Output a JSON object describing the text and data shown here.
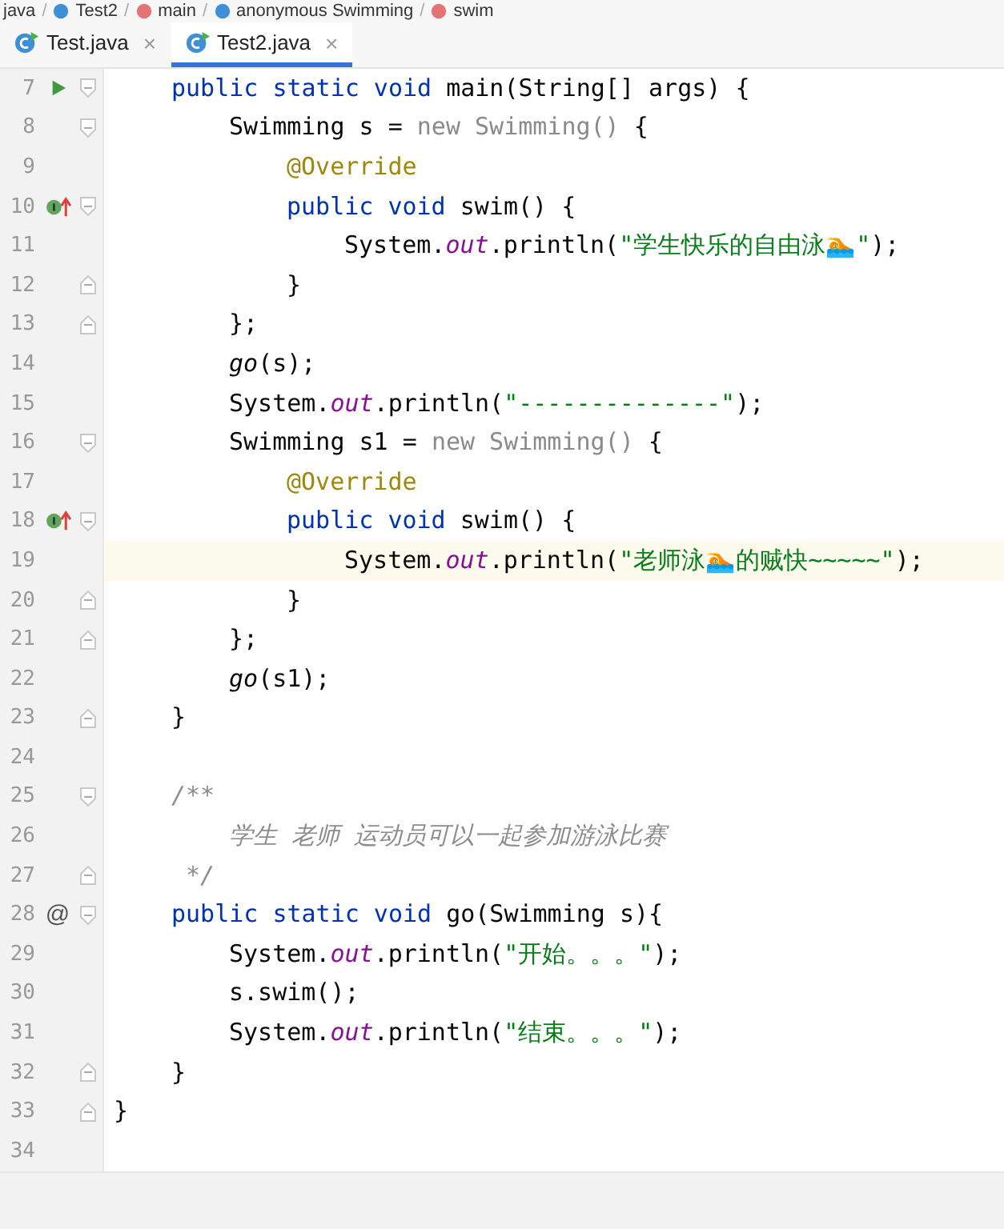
{
  "breadcrumb": [
    {
      "kind": "folder",
      "label": "java",
      "separator": "/"
    },
    {
      "kind": "class",
      "label": "Test2",
      "separator": "/"
    },
    {
      "kind": "method",
      "label": "main",
      "separator": "/"
    },
    {
      "kind": "anon",
      "label": "anonymous Swimming",
      "separator": "/"
    },
    {
      "kind": "method",
      "label": "swim"
    }
  ],
  "tabs": [
    {
      "label": "Test.java",
      "close": "×",
      "selected": false
    },
    {
      "label": "Test2.java",
      "close": "×",
      "selected": true
    }
  ],
  "lines": [
    {
      "num": "7",
      "gutter": {
        "kind": "run"
      },
      "fold": {
        "kind": "open"
      },
      "current": false,
      "tokens": [
        {
          "kind": "kw",
          "t": "public static void "
        },
        {
          "kind": "plain",
          "t": "main(String[] args) {"
        }
      ],
      "children": [
        {
          "num": "8",
          "fold": {
            "kind": "open"
          },
          "current": false,
          "tokens": [
            {
              "kind": "plain",
              "t": "Swimming s = "
            },
            {
              "kind": "dim",
              "t": "new Swimming() "
            },
            {
              "kind": "plain",
              "t": "{"
            }
          ],
          "children": [
            {
              "num": "9",
              "current": false,
              "tokens": [
                {
                  "kind": "ann",
                  "t": "@Override"
                }
              ]
            },
            {
              "num": "10",
              "gutter": {
                "kind": "impl"
              },
              "fold": {
                "kind": "open"
              },
              "current": false,
              "tokens": [
                {
                  "kind": "kw",
                  "t": "public void "
                },
                {
                  "kind": "plain",
                  "t": "swim() {"
                }
              ],
              "children": [
                {
                  "num": "11",
                  "current": false,
                  "tokens": [
                    {
                      "kind": "plain",
                      "t": "System."
                    },
                    {
                      "kind": "field",
                      "t": "out"
                    },
                    {
                      "kind": "plain",
                      "t": ".println("
                    },
                    {
                      "kind": "str",
                      "t": "\"学生快乐的自由泳🏊\""
                    },
                    {
                      "kind": "plain",
                      "t": ");"
                    }
                  ]
                }
              ]
            },
            {
              "num": "12",
              "fold": {
                "kind": "close"
              },
              "current": false,
              "tokens": [
                {
                  "kind": "plain",
                  "t": "}"
                }
              ]
            }
          ]
        },
        {
          "num": "13",
          "fold": {
            "kind": "close"
          },
          "current": false,
          "tokens": [
            {
              "kind": "plain",
              "t": "};"
            }
          ]
        },
        {
          "num": "14",
          "current": false,
          "tokens": [
            {
              "kind": "it",
              "t": "go"
            },
            {
              "kind": "plain",
              "t": "(s);"
            }
          ]
        },
        {
          "num": "15",
          "current": false,
          "tokens": [
            {
              "kind": "plain",
              "t": "System."
            },
            {
              "kind": "field",
              "t": "out"
            },
            {
              "kind": "plain",
              "t": ".println("
            },
            {
              "kind": "str",
              "t": "\"--------------\""
            },
            {
              "kind": "plain",
              "t": ");"
            }
          ]
        },
        {
          "num": "16",
          "fold": {
            "kind": "open"
          },
          "current": false,
          "tokens": [
            {
              "kind": "plain",
              "t": "Swimming s1 = "
            },
            {
              "kind": "dim",
              "t": "new Swimming() "
            },
            {
              "kind": "plain",
              "t": "{"
            }
          ],
          "children": [
            {
              "num": "17",
              "current": false,
              "tokens": [
                {
                  "kind": "ann",
                  "t": "@Override"
                }
              ]
            },
            {
              "num": "18",
              "gutter": {
                "kind": "impl"
              },
              "fold": {
                "kind": "open"
              },
              "current": false,
              "tokens": [
                {
                  "kind": "kw",
                  "t": "public void "
                },
                {
                  "kind": "plain",
                  "t": "swim() {"
                }
              ],
              "children": [
                {
                  "num": "19",
                  "current": true,
                  "tokens": [
                    {
                      "kind": "plain",
                      "t": "System."
                    },
                    {
                      "kind": "field",
                      "t": "out"
                    },
                    {
                      "kind": "plain",
                      "t": ".println("
                    },
                    {
                      "kind": "str",
                      "t": "\"老师泳🏊的贼快~~~~~\""
                    },
                    {
                      "kind": "plain",
                      "t": ");"
                    }
                  ]
                }
              ]
            },
            {
              "num": "20",
              "fold": {
                "kind": "close"
              },
              "current": false,
              "tokens": [
                {
                  "kind": "plain",
                  "t": "}"
                }
              ]
            }
          ]
        },
        {
          "num": "21",
          "fold": {
            "kind": "close"
          },
          "current": false,
          "tokens": [
            {
              "kind": "plain",
              "t": "};"
            }
          ]
        },
        {
          "num": "22",
          "current": false,
          "tokens": [
            {
              "kind": "it",
              "t": "go"
            },
            {
              "kind": "plain",
              "t": "(s1);"
            }
          ]
        }
      ]
    },
    {
      "num": "23",
      "fold": {
        "kind": "close"
      },
      "current": false,
      "tokens": [
        {
          "kind": "plain",
          "t": "}"
        }
      ]
    },
    {
      "num": "24",
      "current": false
    },
    {
      "num": "25",
      "fold": {
        "kind": "open"
      },
      "current": false,
      "tokens": [
        {
          "kind": "com",
          "t": "/**"
        }
      ],
      "children": [
        {
          "num": "26",
          "current": false,
          "tokens": [
            {
              "kind": "com",
              "t": "学生 老师 运动员可以一起参加游泳比赛"
            }
          ]
        }
      ]
    },
    {
      "num": "27",
      "fold": {
        "kind": "close"
      },
      "current": false,
      "tokens": [
        {
          "kind": "comend",
          "t": "*/"
        }
      ]
    },
    {
      "num": "28",
      "gutter": {
        "kind": "text",
        "text": "@"
      },
      "fold": {
        "kind": "open"
      },
      "current": false,
      "tokens": [
        {
          "kind": "kw",
          "t": "public static void "
        },
        {
          "kind": "plain",
          "t": "go(Swimming s){"
        }
      ],
      "children": [
        {
          "num": "29",
          "current": false,
          "tokens": [
            {
              "kind": "plain",
              "t": "System."
            },
            {
              "kind": "field",
              "t": "out"
            },
            {
              "kind": "plain",
              "t": ".println("
            },
            {
              "kind": "str",
              "t": "\"开始。。。\""
            },
            {
              "kind": "plain",
              "t": ");"
            }
          ]
        },
        {
          "num": "30",
          "current": false,
          "tokens": [
            {
              "kind": "plain",
              "t": "s.swim();"
            }
          ]
        },
        {
          "num": "31",
          "current": false,
          "tokens": [
            {
              "kind": "plain",
              "t": "System."
            },
            {
              "kind": "field",
              "t": "out"
            },
            {
              "kind": "plain",
              "t": ".println("
            },
            {
              "kind": "str",
              "t": "\"结束。。。\""
            },
            {
              "kind": "plain",
              "t": ");"
            }
          ]
        }
      ]
    },
    {
      "num": "32",
      "fold": {
        "kind": "close"
      },
      "current": false,
      "tokens": [
        {
          "kind": "plain",
          "t": "}"
        }
      ]
    }
  ],
  "class_end": {
    "num": "33",
    "fold": {
      "kind": "close"
    },
    "current": false,
    "tokens": [
      {
        "kind": "plain",
        "t": "}"
      }
    ]
  },
  "trailing": {
    "num": "34",
    "current": false
  }
}
